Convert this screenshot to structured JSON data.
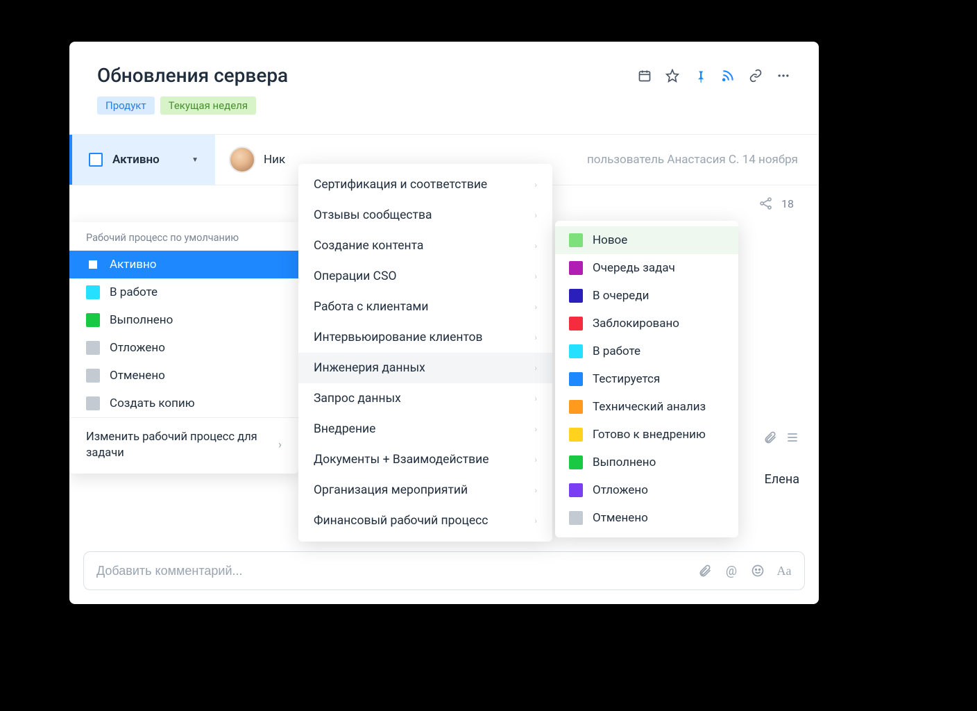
{
  "header": {
    "title": "Обновления сервера",
    "tags": [
      {
        "label": "Продукт",
        "style": "blue"
      },
      {
        "label": "Текущая неделя",
        "style": "green"
      }
    ]
  },
  "row": {
    "status_label": "Активно",
    "assignee_visible": "Ник",
    "meta": "пользователь Анастасия С. 14 ноября"
  },
  "share": {
    "count": "18"
  },
  "status_dropdown": {
    "header": "Рабочий процесс по умолчанию",
    "items": [
      {
        "label": "Активно",
        "color": "#ffffff",
        "active": true
      },
      {
        "label": "В работе",
        "color": "#26e0ff"
      },
      {
        "label": "Выполнено",
        "color": "#1ac943"
      },
      {
        "label": "Отложено",
        "color": "#c4cad1"
      },
      {
        "label": "Отменено",
        "color": "#c4cad1"
      },
      {
        "label": "Создать копию",
        "color": "#c4cad1"
      }
    ],
    "footer": "Изменить рабочий процесс для задачи"
  },
  "workflow_menu": [
    {
      "label": "Сертификация и соответствие"
    },
    {
      "label": "Отзывы сообщества"
    },
    {
      "label": "Создание контента"
    },
    {
      "label": "Операции CSO"
    },
    {
      "label": "Работа с клиентами"
    },
    {
      "label": "Интервьюирование клиентов"
    },
    {
      "label": "Инженерия данных",
      "hover": true
    },
    {
      "label": "Запрос данных"
    },
    {
      "label": "Внедрение"
    },
    {
      "label": "Документы + Взаимодействие"
    },
    {
      "label": "Организация мероприятий"
    },
    {
      "label": "Финансовый рабочий процесс"
    }
  ],
  "status_menu": [
    {
      "label": "Новое",
      "color": "#7de07a",
      "hover": true
    },
    {
      "label": "Очередь задач",
      "color": "#b01eb3"
    },
    {
      "label": "В очереди",
      "color": "#2a1fba"
    },
    {
      "label": "Заблокировано",
      "color": "#f42c3e"
    },
    {
      "label": "В работе",
      "color": "#26e0ff"
    },
    {
      "label": "Тестируется",
      "color": "#1e88ff"
    },
    {
      "label": "Технический анализ",
      "color": "#ff9a1e"
    },
    {
      "label": "Готово к внедрению",
      "color": "#ffd21e"
    },
    {
      "label": "Выполнено",
      "color": "#1ac943"
    },
    {
      "label": "Отложено",
      "color": "#7a3ff2"
    },
    {
      "label": "Отменено",
      "color": "#c4cad1"
    }
  ],
  "side_assignee": "Елена",
  "comment": {
    "placeholder": "Добавить комментарий..."
  }
}
